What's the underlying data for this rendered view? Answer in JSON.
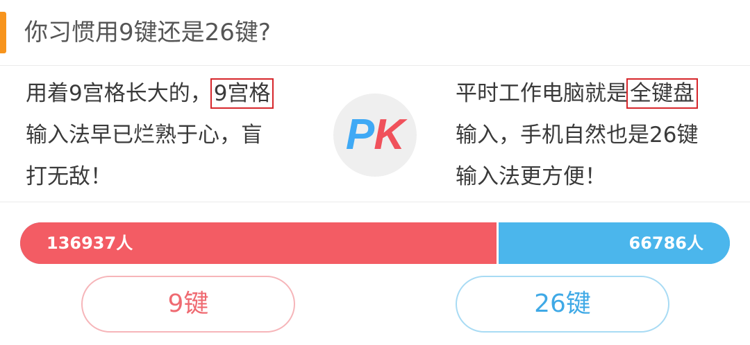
{
  "question": {
    "title": "你习惯用9键还是26键?"
  },
  "left_side": {
    "lines": [
      "用着9宫格长大的，",
      "输入法早已烂熟于心，盲",
      "打无敌！"
    ],
    "highlight": "9宫格",
    "color": "#f35c64"
  },
  "right_side": {
    "lines": [
      "平时工作电脑就是",
      "输入，手机自然也是26键",
      "输入法更方便！"
    ],
    "highlight": "全键盘",
    "color": "#4bb6ec"
  },
  "badge": {
    "p": "P",
    "k": "K"
  },
  "votes": {
    "left_count": "136937人",
    "right_count": "66786人",
    "left_value": 136937,
    "right_value": 66786
  },
  "buttons": {
    "left_label": "9键",
    "right_label": "26键"
  },
  "colors": {
    "accent": "#f7941d",
    "highlight_border": "#d6262b"
  }
}
